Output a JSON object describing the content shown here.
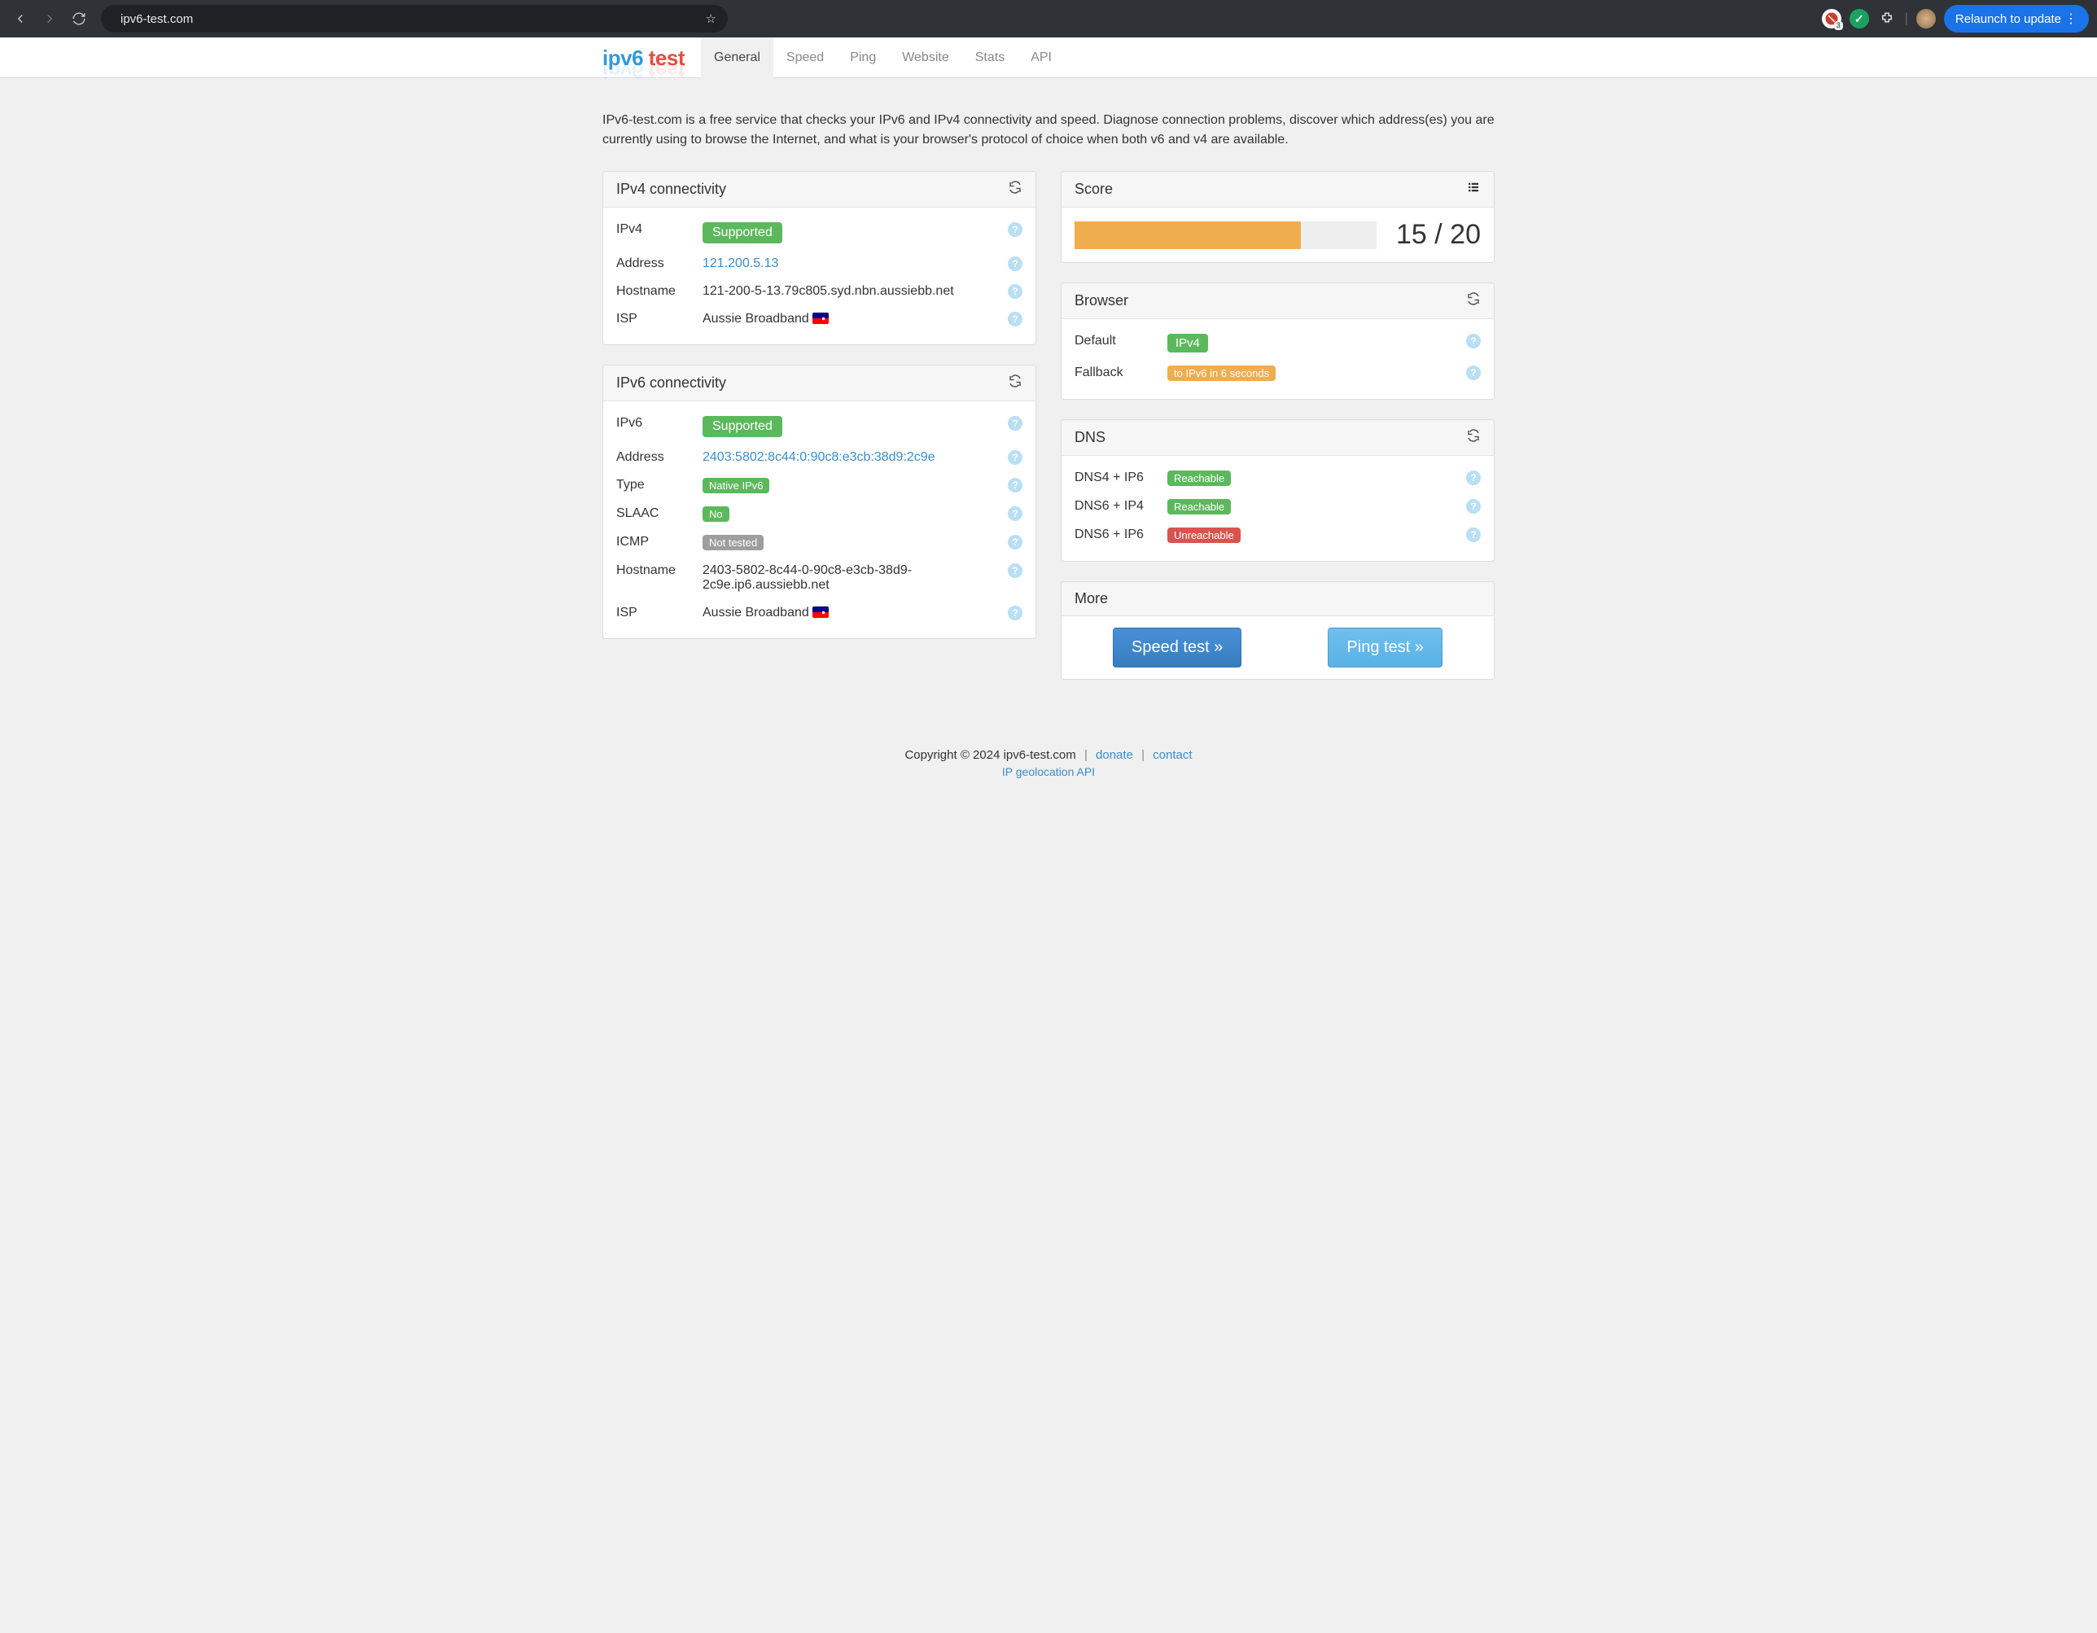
{
  "chrome": {
    "url": "ipv6-test.com",
    "relaunch": "Relaunch to update",
    "notify_count": "3"
  },
  "logo": {
    "ipv6": "ipv6 ",
    "test": "test"
  },
  "nav": [
    "General",
    "Speed",
    "Ping",
    "Website",
    "Stats",
    "API"
  ],
  "intro": "IPv6-test.com is a free service that checks your IPv6 and IPv4 connectivity and speed. Diagnose connection problems, discover which address(es) you are currently using to browse the Internet, and what is your browser's protocol of choice when both v6 and v4 are available.",
  "ipv4": {
    "title": "IPv4 connectivity",
    "rows": {
      "support_label": "IPv4",
      "support_value": "Supported",
      "address_label": "Address",
      "address_value": "121.200.5.13",
      "hostname_label": "Hostname",
      "hostname_value": "121-200-5-13.79c805.syd.nbn.aussiebb.net",
      "isp_label": "ISP",
      "isp_value": "Aussie Broadband"
    }
  },
  "ipv6": {
    "title": "IPv6 connectivity",
    "rows": {
      "support_label": "IPv6",
      "support_value": "Supported",
      "address_label": "Address",
      "address_value": "2403:5802:8c44:0:90c8:e3cb:38d9:2c9e",
      "type_label": "Type",
      "type_value": "Native IPv6",
      "slaac_label": "SLAAC",
      "slaac_value": "No",
      "icmp_label": "ICMP",
      "icmp_value": "Not tested",
      "hostname_label": "Hostname",
      "hostname_value": "2403-5802-8c44-0-90c8-e3cb-38d9-2c9e.ip6.aussiebb.net",
      "isp_label": "ISP",
      "isp_value": "Aussie Broadband"
    }
  },
  "score": {
    "title": "Score",
    "text": "15 / 20",
    "fill_percent": 75
  },
  "browser": {
    "title": "Browser",
    "default_label": "Default",
    "default_value": "IPv4",
    "fallback_label": "Fallback",
    "fallback_value": "to IPv6 in 6 seconds"
  },
  "dns": {
    "title": "DNS",
    "rows": [
      {
        "label": "DNS4 + IP6",
        "value": "Reachable",
        "cls": "pill-green"
      },
      {
        "label": "DNS6 + IP4",
        "value": "Reachable",
        "cls": "pill-green"
      },
      {
        "label": "DNS6 + IP6",
        "value": "Unreachable",
        "cls": "pill-red"
      }
    ]
  },
  "more": {
    "title": "More",
    "speed": "Speed test »",
    "ping": "Ping test »"
  },
  "footer": {
    "copyright": "Copyright © 2024 ipv6-test.com",
    "donate": "donate",
    "contact": "contact",
    "sub": "IP geolocation API"
  }
}
